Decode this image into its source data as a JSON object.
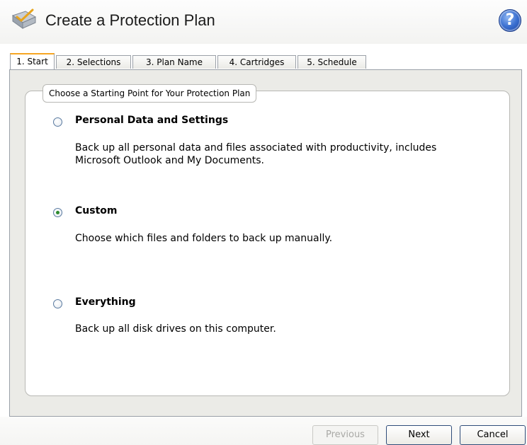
{
  "header": {
    "title": "Create a Protection Plan",
    "help_label": "?"
  },
  "tabs": [
    {
      "label": "1. Start",
      "active": true
    },
    {
      "label": "2. Selections",
      "active": false
    },
    {
      "label": "3. Plan Name",
      "active": false
    },
    {
      "label": "4. Cartridges",
      "active": false
    },
    {
      "label": "5. Schedule",
      "active": false
    }
  ],
  "group": {
    "legend": "Choose a Starting Point for Your Protection Plan"
  },
  "options": [
    {
      "title": "Personal Data and Settings",
      "description": "Back up all personal data and files associated with productivity, includes Microsoft Outlook and My Documents.",
      "selected": false
    },
    {
      "title": "Custom",
      "description": "Choose which files and folders to back up manually.",
      "selected": true
    },
    {
      "title": "Everything",
      "description": "Back up all disk drives on this computer.",
      "selected": false
    }
  ],
  "footer": {
    "previous_label": "Previous",
    "next_label": "Next",
    "cancel_label": "Cancel"
  },
  "colors": {
    "active_tab_accent": "#f6a623",
    "radio_checked": "#2d8a2d",
    "help_blue": "#3a6fd0"
  }
}
